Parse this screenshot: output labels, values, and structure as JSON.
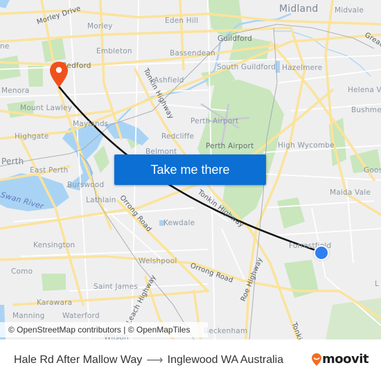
{
  "map": {
    "labels": {
      "midland": "Midland",
      "midvale": "Midvale",
      "great": "Great",
      "morley_drive": "Morley Drive",
      "morley": "Morley",
      "eden_hill": "Eden Hill",
      "guildford": "Guildford",
      "embleton": "Embleton",
      "bassendean": "Bassendean",
      "bedford": "Bedford",
      "ashfield": "Ashfield",
      "south_guildford": "South Guildford",
      "hazelmere": "Hazelmere",
      "helena_valley": "Helena Va",
      "menora": "Menora",
      "inglewood_partial": "ne",
      "tonkin_highway_north": "Tonkin Highway",
      "mount_lawley": "Mount Lawley",
      "maylands": "Maylands",
      "perth_airport_area": "Perth Airport",
      "perth_airport": "Perth Airport",
      "bushmead": "Bushmead",
      "highgate": "Highgate",
      "redcliffe": "Redcliffe",
      "belmont": "Belmont",
      "high_wycombe": "High Wycombe",
      "perth": "Perth",
      "east_perth": "East Perth",
      "gooseberry_partial": "Goos",
      "maida_vale": "Maida Vale",
      "swan_river": "Swan River",
      "burswood": "Burswood",
      "lathlain": "Lathlain",
      "orrong_road_west": "Orrong Road",
      "tonkin_highway_south": "Tonkin Highway",
      "kewdale": "Kewdale",
      "forrestfield": "Forrestfield",
      "kensington": "Kensington",
      "welshpool": "Welshpool",
      "orrong_road_east": "Orrong Road",
      "roe_highway": "Roe Highway",
      "como": "Como",
      "saint_james": "Saint James",
      "leach_highway": "Leach Highway",
      "lesmurdie_partial": "L",
      "karawara": "Karawara",
      "manning": "Manning",
      "waterford": "Waterford",
      "wilson": "Wilson",
      "beckenham": "Beckenham",
      "tonkin_highway_bottom": "Tonki"
    },
    "cta_label": "Take me there",
    "attribution": "© OpenStreetMap contributors | © OpenMapTiles",
    "origin_marker": "origin-pin-icon",
    "destination_marker": "destination-dot"
  },
  "footer": {
    "origin": "Hale Rd After Mallow Way",
    "arrow": "⟶",
    "destination": "Inglewood WA Australia",
    "brand": "moovit"
  },
  "colors": {
    "land": "#efeff0",
    "road": "#fbe39b",
    "minor_road": "#ffffff",
    "water": "#a9d3f5",
    "park": "#c9e6bd",
    "route_line": "#111111",
    "cta": "#0b6fd4",
    "origin_pin": "#f0511c",
    "destination_dot": "#2f7ff2",
    "brand_orange": "#f26d21"
  }
}
